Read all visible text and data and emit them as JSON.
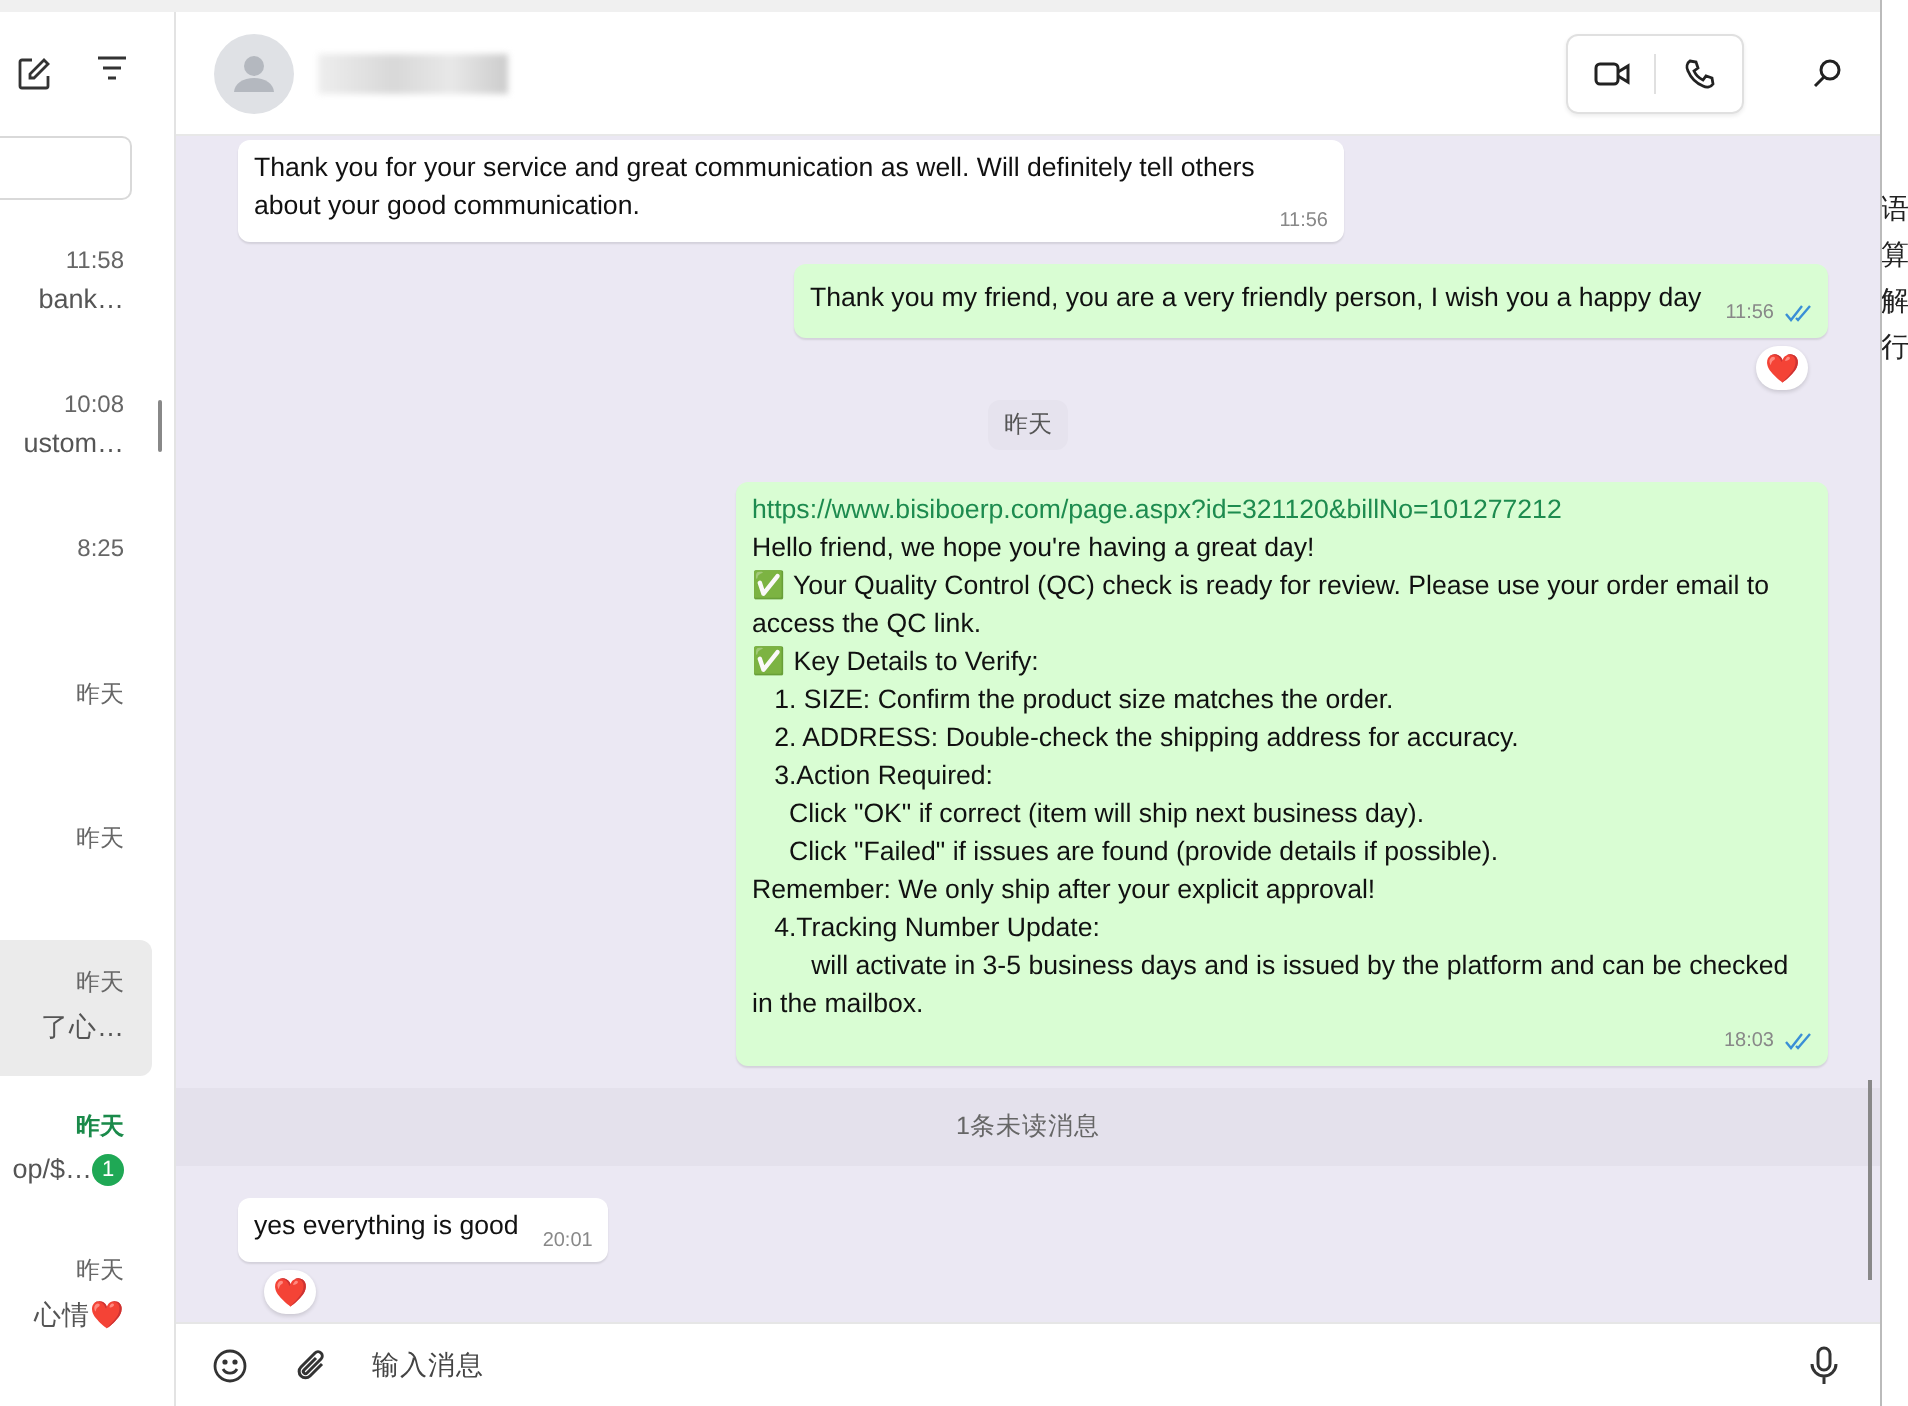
{
  "sidebar": {
    "chats": [
      {
        "time": "11:58",
        "preview": "bank…",
        "selected": false,
        "unread": false
      },
      {
        "time": "10:08",
        "preview": "ustom…",
        "selected": false,
        "unread": false
      },
      {
        "time": "8:25",
        "selected": false,
        "unread": false
      },
      {
        "time": "昨天",
        "selected": false,
        "unread": false
      },
      {
        "time": "昨天",
        "selected": false,
        "unread": false
      },
      {
        "time": "昨天",
        "preview": "了心…",
        "selected": true,
        "unread": false
      },
      {
        "time": "昨天",
        "preview": "op/$…",
        "selected": false,
        "unread": true,
        "badge": "1"
      },
      {
        "time": "昨天",
        "preview": "心情❤️",
        "selected": false,
        "unread": false
      }
    ]
  },
  "messages": [
    {
      "kind": "incoming",
      "text": "Thank you for your service and great communication as well. Will definitely tell others about your good communication.",
      "time": "11:56"
    },
    {
      "kind": "outgoing",
      "text": "Thank you my friend, you are a very friendly person, I wish you a happy day",
      "time": "11:56",
      "read": true,
      "reaction": "❤️"
    },
    {
      "kind": "date",
      "text": "昨天"
    },
    {
      "kind": "outgoing",
      "link": "https://www.bisiboerp.com/page.aspx?id=321120&billNo=101277212",
      "text": "Hello friend, we hope you're having a great day!\n✅ Your Quality Control (QC) check is ready for review. Please use your order email to access the QC link.\n✅ Key Details to Verify:\n   1. SIZE: Confirm the product size matches the order.\n   2. ADDRESS: Double-check the shipping address for accuracy.\n   3.Action Required:\n     Click \"OK\" if correct (item will ship next business day).\n     Click \"Failed\" if issues are found (provide details if possible).\nRemember: We only ship after your explicit approval!\n   4.Tracking Number Update:\n        will activate in 3-5 business days and is issued by the platform and can be checked in the mailbox.",
      "time": "18:03",
      "read": true
    },
    {
      "kind": "unread",
      "text": "1条未读消息"
    },
    {
      "kind": "incoming",
      "text": "yes everything is good",
      "time": "20:01",
      "reaction": "❤️"
    }
  ],
  "composer": {
    "placeholder": "输入消息"
  },
  "background_window": {
    "lines": [
      "语",
      "算",
      "解",
      "行"
    ]
  }
}
